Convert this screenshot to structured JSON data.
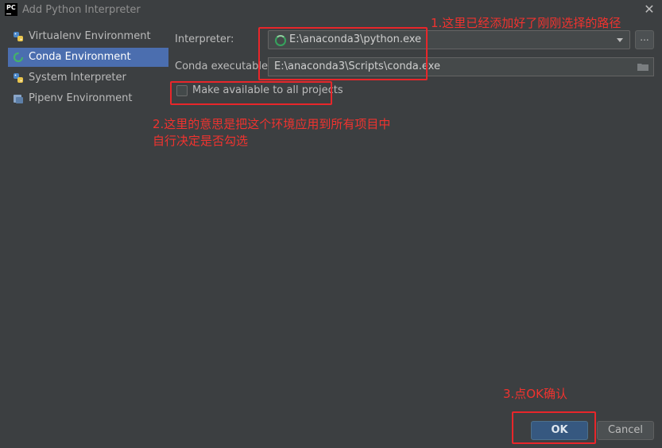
{
  "window": {
    "title": "Add Python Interpreter",
    "logo_text": "PC"
  },
  "sidebar": {
    "items": [
      {
        "label": "Virtualenv Environment",
        "icon": "python-icon",
        "selected": false
      },
      {
        "label": "Conda Environment",
        "icon": "conda-icon",
        "selected": true
      },
      {
        "label": "System Interpreter",
        "icon": "python-icon",
        "selected": false
      },
      {
        "label": "Pipenv Environment",
        "icon": "pipenv-icon",
        "selected": false
      }
    ]
  },
  "form": {
    "interpreter_label": "Interpreter:",
    "interpreter_value": "E:\\anaconda3\\python.exe",
    "browse_label": "...",
    "conda_label": "Conda executable:",
    "conda_value": "E:\\anaconda3\\Scripts\\conda.exe",
    "checkbox_label": "Make available to all projects",
    "checkbox_checked": false
  },
  "annotations": {
    "note1": "1.这里已经添加好了刚刚选择的路径",
    "note2_line1": "2.这里的意思是把这个环境应用到所有项目中",
    "note2_line2": "自行决定是否勾选",
    "note3": "3.点OK确认",
    "color": "#e8262a"
  },
  "buttons": {
    "ok": "OK",
    "cancel": "Cancel"
  },
  "colors": {
    "background": "#3c3f41",
    "selection": "#4b6eaf",
    "ok_button": "#365880"
  }
}
